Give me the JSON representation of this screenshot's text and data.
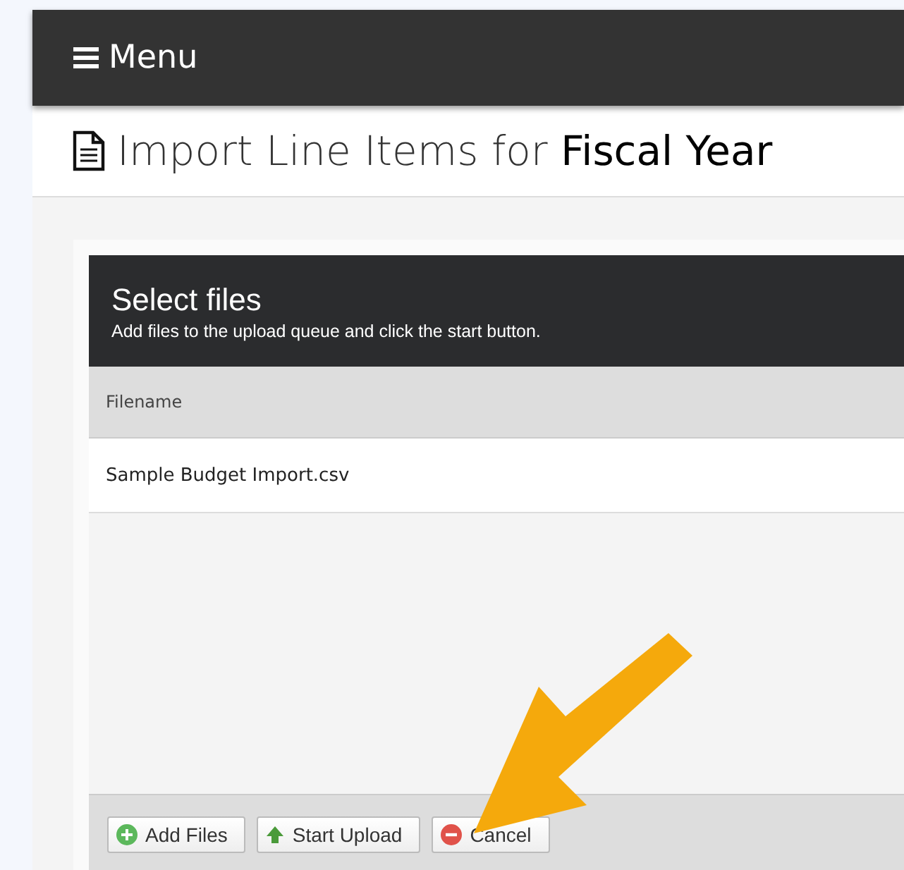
{
  "navbar": {
    "menu_label": "Menu"
  },
  "page_title": {
    "prefix": "Import Line Items for ",
    "emphasis": "Fiscal Year"
  },
  "uploader": {
    "title": "Select files",
    "subtitle": "Add files to the upload queue and click the start button.",
    "columns": [
      "Filename"
    ],
    "files": [
      "Sample Budget Import.csv"
    ],
    "buttons": [
      {
        "label": "Add Files",
        "kind": "add"
      },
      {
        "label": "Start Upload",
        "kind": "start"
      },
      {
        "label": "Cancel",
        "kind": "cancel"
      }
    ]
  }
}
